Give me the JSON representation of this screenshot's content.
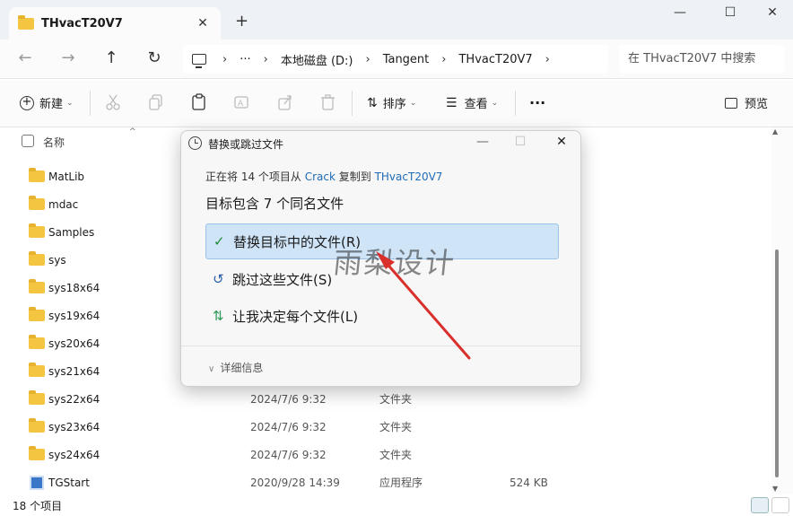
{
  "window": {
    "tab_title": "THvacT20V7",
    "new_tab": "+",
    "minimize": "—",
    "maximize": "☐",
    "close": "✕"
  },
  "address": {
    "crumbs": [
      "本地磁盘 (D:)",
      "Tangent",
      "THvacT20V7"
    ],
    "ellipsis": "···",
    "search_placeholder": "在 THvacT20V7 中搜索"
  },
  "toolbar": {
    "new_label": "新建",
    "sort_label": "排序",
    "view_label": "查看",
    "more_label": "···",
    "preview_label": "预览"
  },
  "list": {
    "header_name": "名称",
    "rows": [
      {
        "name": "MatLib",
        "date": "",
        "type": "",
        "size": "",
        "kind": "folder"
      },
      {
        "name": "mdac",
        "date": "",
        "type": "",
        "size": "",
        "kind": "folder"
      },
      {
        "name": "Samples",
        "date": "",
        "type": "",
        "size": "",
        "kind": "folder"
      },
      {
        "name": "sys",
        "date": "",
        "type": "",
        "size": "",
        "kind": "folder"
      },
      {
        "name": "sys18x64",
        "date": "",
        "type": "",
        "size": "",
        "kind": "folder"
      },
      {
        "name": "sys19x64",
        "date": "",
        "type": "",
        "size": "",
        "kind": "folder"
      },
      {
        "name": "sys20x64",
        "date": "",
        "type": "",
        "size": "",
        "kind": "folder"
      },
      {
        "name": "sys21x64",
        "date": "",
        "type": "",
        "size": "",
        "kind": "folder"
      },
      {
        "name": "sys22x64",
        "date": "2024/7/6 9:32",
        "type": "文件夹",
        "size": "",
        "kind": "folder"
      },
      {
        "name": "sys23x64",
        "date": "2024/7/6 9:32",
        "type": "文件夹",
        "size": "",
        "kind": "folder"
      },
      {
        "name": "sys24x64",
        "date": "2024/7/6 9:32",
        "type": "文件夹",
        "size": "",
        "kind": "folder"
      },
      {
        "name": "TGStart",
        "date": "2020/9/28 14:39",
        "type": "应用程序",
        "size": "524 KB",
        "kind": "exe"
      }
    ]
  },
  "status": {
    "item_count": "18 个项目"
  },
  "dialog": {
    "title": "替换或跳过文件",
    "info_prefix": "正在将 14 个项目从 ",
    "info_source": "Crack",
    "info_middle": " 复制到 ",
    "info_dest": "THvacT20V7",
    "heading": "目标包含 7 个同名文件",
    "options": [
      {
        "icon": "✓",
        "label": "替换目标中的文件(R)"
      },
      {
        "icon": "↺",
        "label": "跳过这些文件(S)"
      },
      {
        "icon": "⇅",
        "label": "让我决定每个文件(L)"
      }
    ],
    "details_label": "详细信息",
    "minimize": "—",
    "maximize": "☐",
    "close": "✕"
  },
  "watermark": "雨梨设计",
  "colors": {
    "accent_blue": "#1f6bb5",
    "selected_option_bg": "#cfe4f7",
    "arrow_red": "#d9302c",
    "folder_yellow": "#f4c541"
  }
}
